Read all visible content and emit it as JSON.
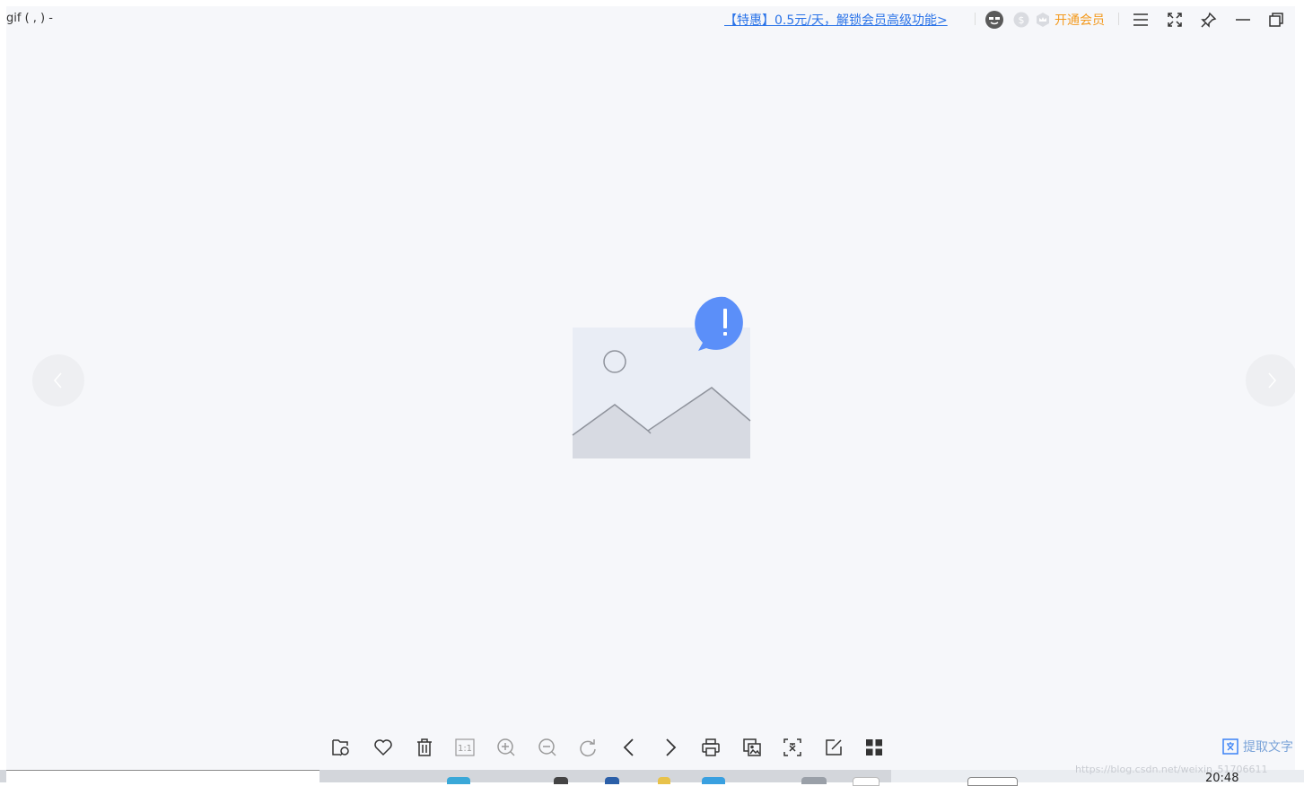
{
  "window": {
    "title": "gif ( , ) -",
    "promo_text": "【特惠】0.5元/天，解锁会员高级功能>",
    "vip_label": "开通会员"
  },
  "titlebar_icons": [
    "avatar",
    "coin-icon",
    "crown-badge-icon",
    "menu-icon",
    "fullscreen-icon",
    "pin-icon",
    "minimize-icon",
    "restore-icon"
  ],
  "toolbar": {
    "items": [
      "open-folder-icon",
      "favorite-icon",
      "delete-icon",
      "actual-size-icon",
      "zoom-in-icon",
      "zoom-out-icon",
      "rotate-icon",
      "previous-icon",
      "next-icon",
      "print-icon",
      "copy-image-icon",
      "crop-icon",
      "edit-icon",
      "grid-view-icon"
    ],
    "actual_size_label": "1:1",
    "ocr_label": "提取文字"
  },
  "watermark": "https://blog.csdn.net/weixin_51706611",
  "taskbar": {
    "clock": "20:48"
  },
  "colors": {
    "accent_blue": "#5b8ff9",
    "promo_blue": "#2a73e8",
    "vip_orange": "#f39a1e",
    "viewer_bg": "#f6f7fa"
  }
}
